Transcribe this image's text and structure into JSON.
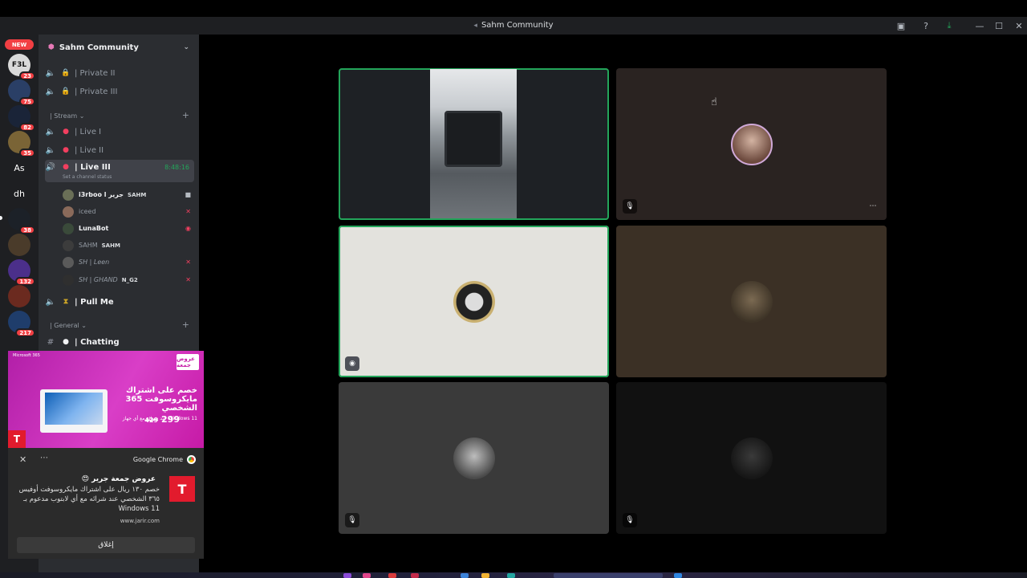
{
  "window": {
    "title": "Sahm Community"
  },
  "titlebar_icons": [
    "inbox-icon",
    "help-icon",
    "download-icon",
    "minimize-icon",
    "maximize-icon",
    "close-icon"
  ],
  "server_rail": {
    "new_label": "NEW",
    "servers": [
      {
        "label": "F3L",
        "badge": "23"
      },
      {
        "label": "",
        "badge": "75"
      },
      {
        "label": "",
        "badge": "82"
      },
      {
        "label": "",
        "badge": "35"
      },
      {
        "label": "As",
        "badge": ""
      },
      {
        "label": "dh",
        "badge": ""
      },
      {
        "label": "",
        "badge": "38"
      },
      {
        "label": "",
        "badge": ""
      },
      {
        "label": "",
        "badge": "132"
      },
      {
        "label": "",
        "badge": ""
      },
      {
        "label": "",
        "badge": "217"
      }
    ]
  },
  "server": {
    "name": "Sahm Community"
  },
  "channels": {
    "top": [
      {
        "name": "| Private II"
      },
      {
        "name": "| Private III"
      }
    ],
    "stream_category": "| Stream",
    "stream": [
      {
        "name": "| Live I"
      },
      {
        "name": "| Live II"
      },
      {
        "name": "| Live III",
        "timer": "8:48:16",
        "status_placeholder": "Set a channel status"
      }
    ],
    "voice_users": [
      {
        "name": "i3rboo l جرير",
        "tag": "SAHM"
      },
      {
        "name": "iceed",
        "tag": ""
      },
      {
        "name": "LunaBot",
        "tag": ""
      },
      {
        "name": "SAHM",
        "tag": "SAHM"
      },
      {
        "name": "SH | Leen",
        "tag": ""
      },
      {
        "name": "SH | GHAND",
        "tag": "N_G2"
      }
    ],
    "pull_me": "| Pull Me",
    "general_category": "| General",
    "chatting": "| Chatting"
  },
  "ad": {
    "brand": "Microsoft 365",
    "badge": "عروض جمعة",
    "headline": "خصم على اشتراك مايكروسوفت 365 الشخصي",
    "sub": "عند شرائه مع أي جهاز Windows 11",
    "price_old": "429",
    "price_new": "299"
  },
  "notification": {
    "app": "Google Chrome",
    "title": "عروض جمعة جرير 😍",
    "body": "خصم ١٣٠ ريال على اشتراك مايكروسوفت أوفيس ٣٦٥ الشخصي عند شرائه مع أي لابتوب مدعوم بـ Windows 11",
    "url": "www.jarir.com",
    "button": "إغلاق"
  },
  "colors": {
    "accent_green": "#23a55a",
    "badge_red": "#f23f43",
    "live_red": "#f23f5f"
  }
}
